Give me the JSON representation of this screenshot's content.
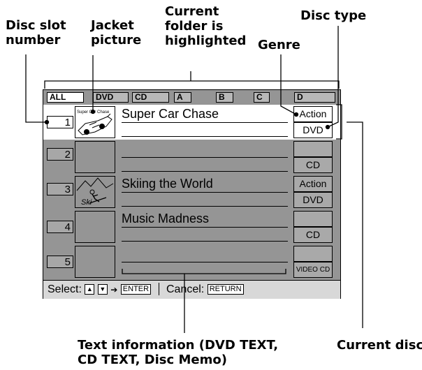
{
  "callouts": {
    "disc_slot_number": [
      "Disc slot",
      "number"
    ],
    "jacket_picture": [
      "Jacket",
      "picture"
    ],
    "current_folder": [
      "Current",
      "folder is",
      "highlighted"
    ],
    "genre": "Genre",
    "disc_type": "Disc type",
    "text_information": [
      "Text information (DVD TEXT,",
      "CD TEXT, Disc Memo)"
    ],
    "current_disc": "Current disc"
  },
  "screen": {
    "tabs": [
      {
        "label": "ALL",
        "active": true
      },
      {
        "label": "DVD",
        "active": false
      },
      {
        "label": "CD",
        "active": false
      },
      {
        "label": "A",
        "active": false
      },
      {
        "label": "B",
        "active": false
      },
      {
        "label": "C",
        "active": false
      },
      {
        "label": "D",
        "active": false
      }
    ],
    "rows": [
      {
        "slot": "1",
        "title": "Super Car Chase",
        "genre": "Action",
        "type": "DVD",
        "jacket_text": "Super Car Chase"
      },
      {
        "slot": "2",
        "title": "",
        "genre": "",
        "type": "CD",
        "jacket_text": ""
      },
      {
        "slot": "3",
        "title": "Skiing the World",
        "genre": "Action",
        "type": "DVD",
        "jacket_text": "Ski"
      },
      {
        "slot": "4",
        "title": "Music Madness",
        "genre": "",
        "type": "CD",
        "jacket_text": ""
      },
      {
        "slot": "5",
        "title": "",
        "genre": "",
        "type": "VIDEO CD",
        "jacket_text": ""
      }
    ],
    "status": {
      "select_label": "Select:",
      "up_arrow": "▲",
      "down_arrow": "▼",
      "arrow": "➔",
      "enter_key": "ENTER",
      "cancel_label": "Cancel:",
      "return_key": "RETURN"
    }
  },
  "colors": {
    "screen_gray": "#959595",
    "highlight": "#ffffff",
    "status_bar": "#d8d8d8"
  }
}
